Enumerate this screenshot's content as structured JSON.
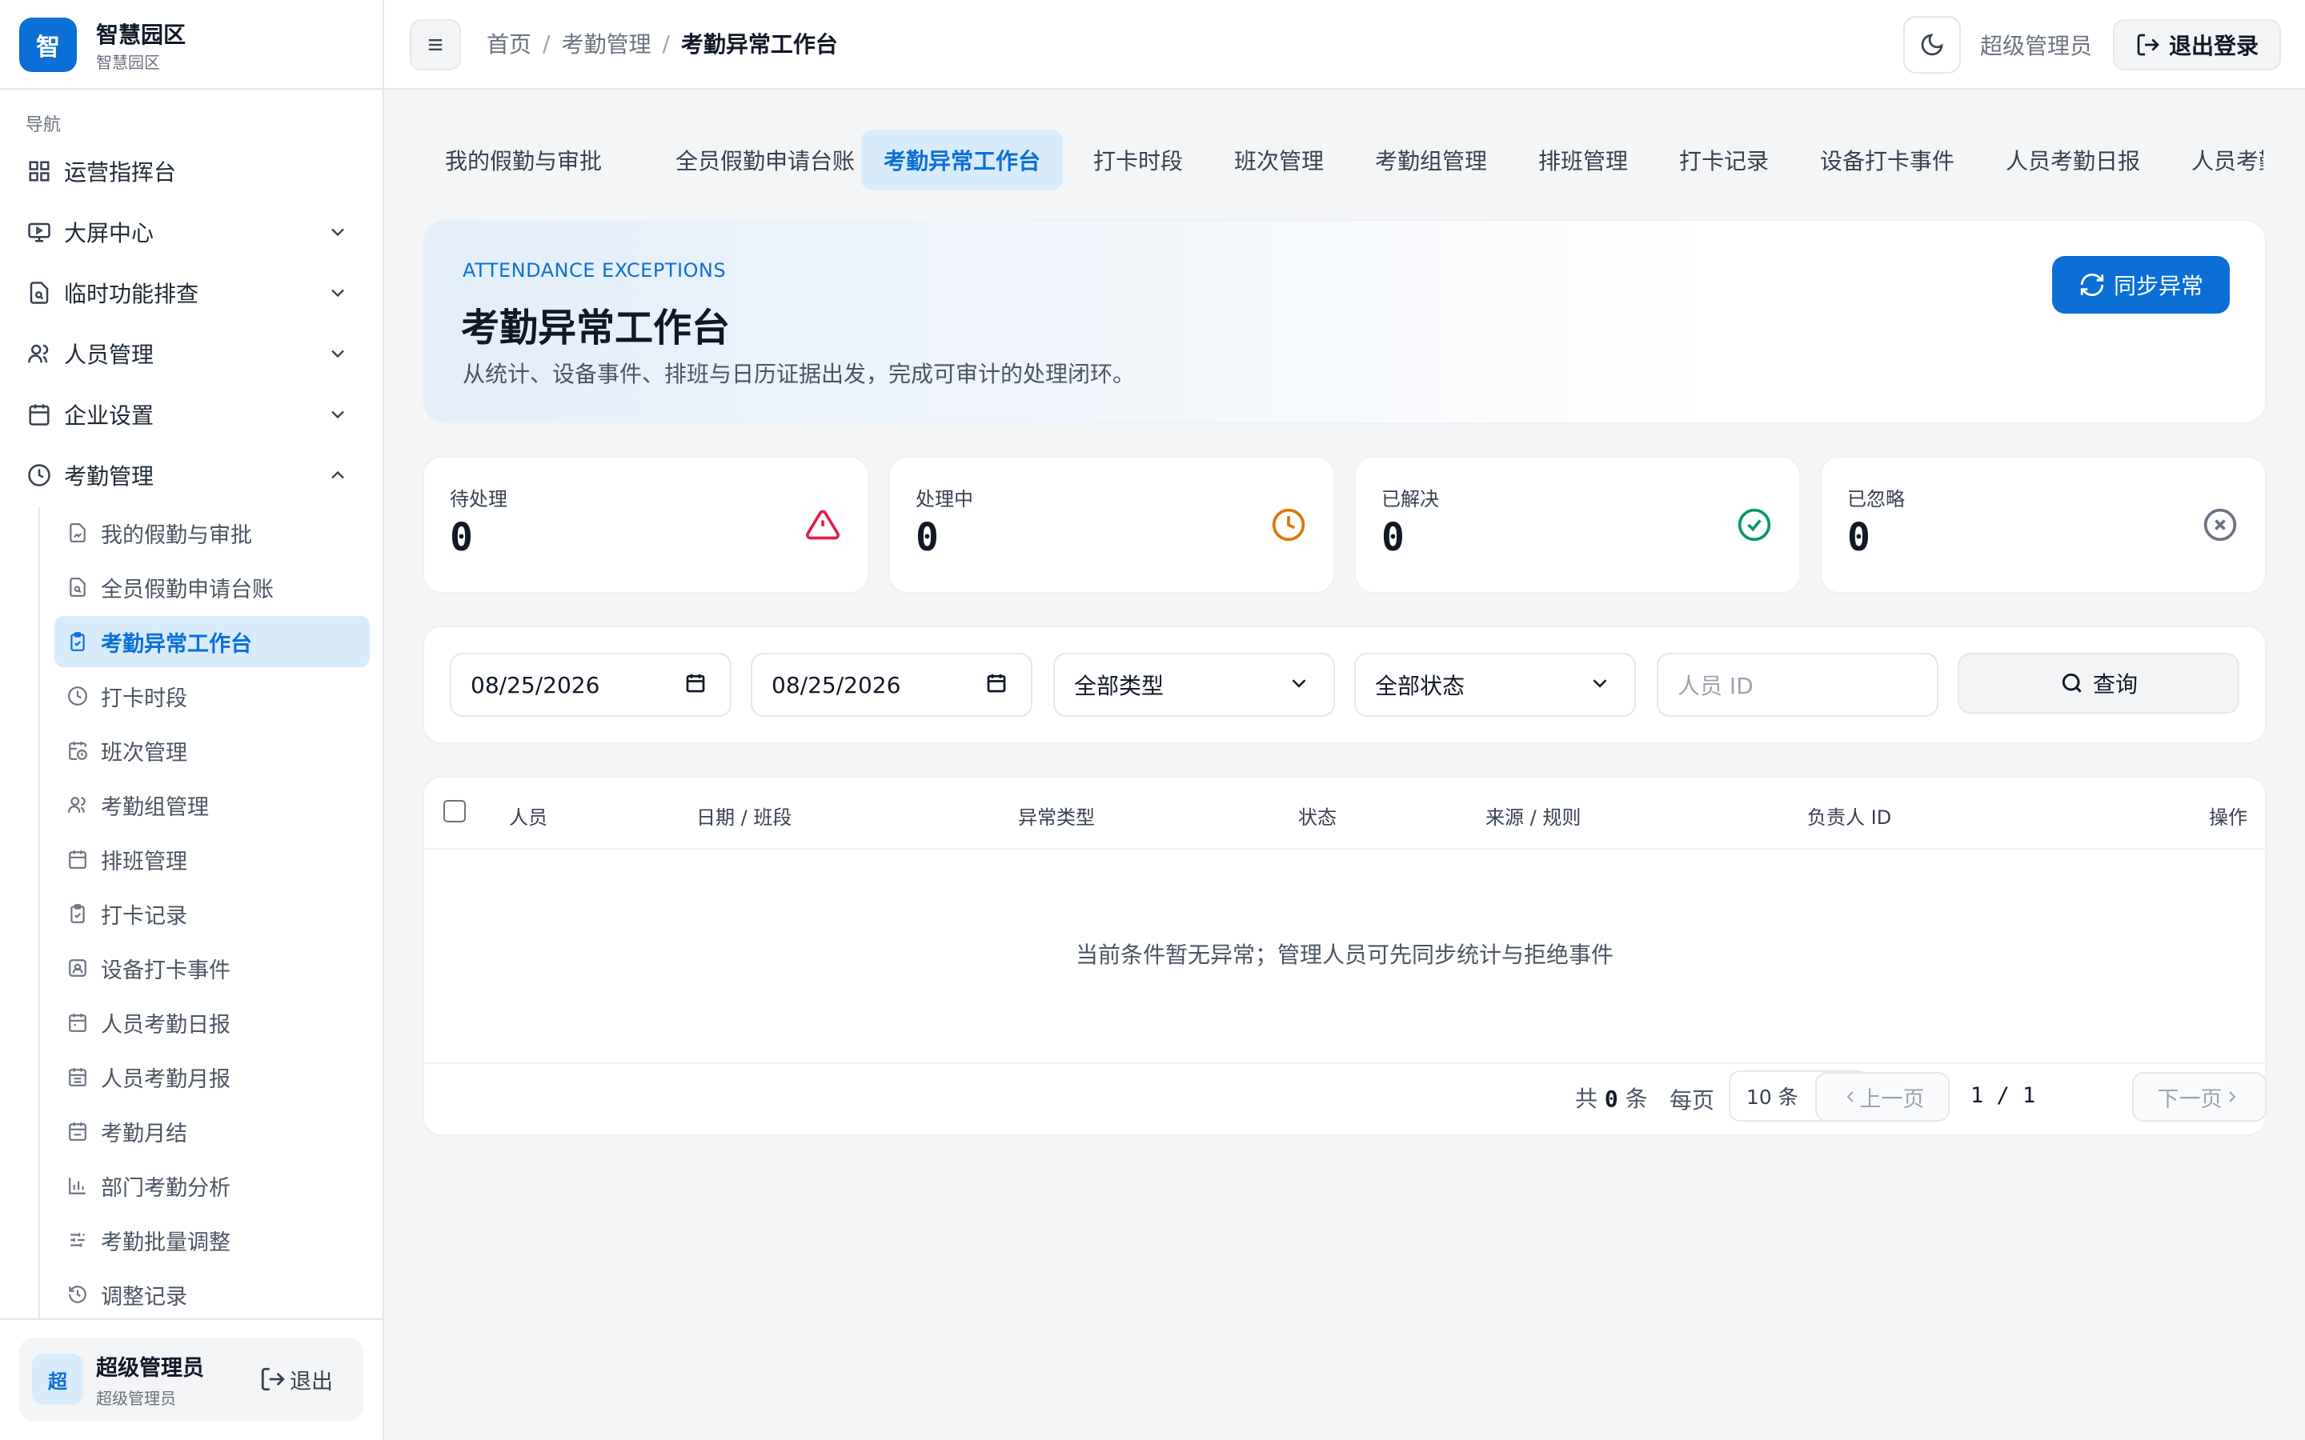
{
  "brand": {
    "logo_char": "智",
    "name": "智慧园区",
    "sub": "智慧园区"
  },
  "nav": {
    "section_label": "导航",
    "items": [
      {
        "label": "运营指挥台",
        "icon": "dashboard-icon"
      },
      {
        "label": "大屏中心",
        "icon": "screen-icon"
      },
      {
        "label": "临时功能排查",
        "icon": "file-search-icon"
      },
      {
        "label": "人员管理",
        "icon": "users-icon"
      },
      {
        "label": "企业设置",
        "icon": "calendar-icon"
      },
      {
        "label": "考勤管理",
        "icon": "clock-icon"
      }
    ],
    "sub_items": [
      {
        "label": "我的假勤与审批",
        "icon": "file-sign-icon"
      },
      {
        "label": "全员假勤申请台账",
        "icon": "file-search-icon"
      },
      {
        "label": "考勤异常工作台",
        "icon": "clipboard-check-icon"
      },
      {
        "label": "打卡时段",
        "icon": "clock-icon"
      },
      {
        "label": "班次管理",
        "icon": "calendar-clock-icon"
      },
      {
        "label": "考勤组管理",
        "icon": "users-icon"
      },
      {
        "label": "排班管理",
        "icon": "calendar-icon"
      },
      {
        "label": "打卡记录",
        "icon": "clipboard-check-icon"
      },
      {
        "label": "设备打卡事件",
        "icon": "scan-face-icon"
      },
      {
        "label": "人员考勤日报",
        "icon": "calendar-day-icon"
      },
      {
        "label": "人员考勤月报",
        "icon": "calendar-month-icon"
      },
      {
        "label": "考勤月结",
        "icon": "calendar-check-icon"
      },
      {
        "label": "部门考勤分析",
        "icon": "bar-chart-icon"
      },
      {
        "label": "考勤批量调整",
        "icon": "sliders-icon"
      },
      {
        "label": "调整记录",
        "icon": "history-icon"
      }
    ]
  },
  "sidebar_user": {
    "avatar": "超",
    "name": "超级管理员",
    "role": "超级管理员",
    "logout": "退出"
  },
  "header": {
    "breadcrumb": [
      "首页",
      "考勤管理",
      "考勤异常工作台"
    ],
    "user": "超级管理员",
    "logout": "退出登录"
  },
  "tabs": [
    "我的假勤与审批",
    "全员假勤申请台账",
    "考勤异常工作台",
    "打卡时段",
    "班次管理",
    "考勤组管理",
    "排班管理",
    "打卡记录",
    "设备打卡事件",
    "人员考勤日报",
    "人员考勤"
  ],
  "hero": {
    "kicker": "ATTENDANCE EXCEPTIONS",
    "title": "考勤异常工作台",
    "desc": "从统计、设备事件、排班与日历证据出发，完成可审计的处理闭环。",
    "sync_button": "同步异常"
  },
  "stats": [
    {
      "label": "待处理",
      "value": "0",
      "icon": "alert-triangle-icon",
      "color": "#e11d48"
    },
    {
      "label": "处理中",
      "value": "0",
      "icon": "clock-icon",
      "color": "#d97706"
    },
    {
      "label": "已解决",
      "value": "0",
      "icon": "check-circle-icon",
      "color": "#059669"
    },
    {
      "label": "已忽略",
      "value": "0",
      "icon": "x-circle-icon",
      "color": "#6b7280"
    }
  ],
  "filters": {
    "date_from": "08/25/2026",
    "date_to": "08/25/2026",
    "type": "全部类型",
    "status": "全部状态",
    "person_placeholder": "人员 ID",
    "query_button": "查询"
  },
  "table": {
    "columns": [
      "人员",
      "日期 / 班段",
      "异常类型",
      "状态",
      "来源 / 规则",
      "负责人 ID",
      "操作"
    ],
    "empty_text": "当前条件暂无异常；管理人员可先同步统计与拒绝事件",
    "total_prefix": "共",
    "total": "0",
    "total_suffix": "条",
    "per_page_label": "每页",
    "per_page": "10 条",
    "prev": "上一页",
    "page_info": "1 / 1",
    "next": "下一页"
  },
  "colors": {
    "accent": "#0b6fd6",
    "accent_soft": "#d8ebfb"
  }
}
